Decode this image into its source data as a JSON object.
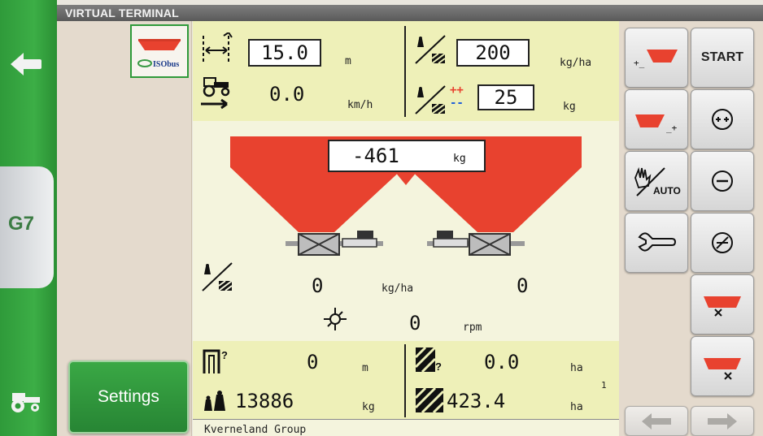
{
  "title": "VIRTUAL TERMINAL",
  "sidebar": {
    "items": [
      {
        "icon": "back-arrow-icon"
      },
      {
        "icon": "g7-terminal-icon",
        "label": "G7"
      },
      {
        "icon": "tractor-icon"
      }
    ]
  },
  "isobus_logo_text": "ISObus",
  "settings_label": "Settings",
  "work": {
    "width_value": "15.0",
    "width_unit": "m",
    "speed_value": "0.0",
    "speed_unit": "km/h",
    "rate_value": "200",
    "rate_unit": "kg/ha",
    "step_value": "25",
    "step_unit": "kg",
    "step_plus": "++",
    "step_minus": "--"
  },
  "hopper": {
    "weight_value": "-461",
    "weight_unit": "kg"
  },
  "actual": {
    "left_rate": "0",
    "rate_unit": "kg/ha",
    "right_rate": "0",
    "disc_speed": "0",
    "disc_unit": "rpm"
  },
  "totals": {
    "distance_value": "0",
    "distance_unit": "m",
    "mass_value": "13886",
    "mass_unit": "kg",
    "area_partial_value": "0.0",
    "area_partial_unit": "ha",
    "area_total_value": "423.4",
    "area_total_unit": "ha",
    "counter_index": "1"
  },
  "footer": "Kverneland Group",
  "buttons": {
    "start": "START",
    "minus_label": "+_",
    "plus_label": "_+",
    "manual_auto_label": "AUTO"
  },
  "colors": {
    "hopper": "#e8422f",
    "green": "#2f9a3a",
    "panel": "#f4f4dd",
    "highlight": "#eef0b8"
  }
}
